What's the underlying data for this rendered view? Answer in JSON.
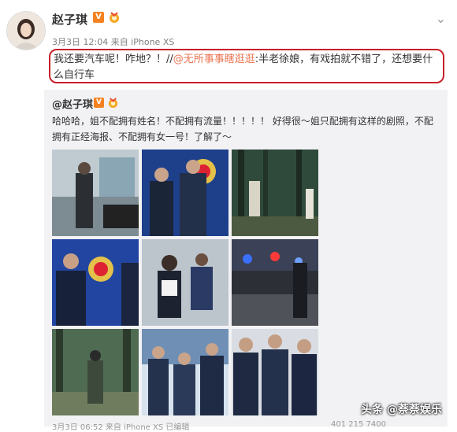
{
  "post": {
    "author": "赵子琪",
    "verified_badge": "V",
    "meta": "3月3日 12:04 来自 iPhone XS",
    "body_prefix": "我还要汽车呢！咋地？！//",
    "mention": "@无所事事瞎逛逛",
    "body_suffix": ":半老徐娘，有戏拍就不错了，还想要什么自行车"
  },
  "repost": {
    "author": "@赵子琪",
    "verified_badge": "V",
    "text": "哈哈哈，姐不配拥有姓名！不配拥有流量！！！！！ 好得很～姐只配拥有这样的剧照，不配拥有正经海报、不配拥有女一号！了解了～",
    "photos": [
      {
        "name": "office-man"
      },
      {
        "name": "police-officers-emblem"
      },
      {
        "name": "forest-scene"
      },
      {
        "name": "police-officer-emblem-2"
      },
      {
        "name": "running-scene"
      },
      {
        "name": "night-police-cars"
      },
      {
        "name": "forest-walk"
      },
      {
        "name": "police-group"
      },
      {
        "name": "police-trio"
      }
    ]
  },
  "footer": {
    "meta": "3月3日 06:52 来自 iPhone XS 已编辑",
    "stats": "401  215  7400"
  },
  "watermark": "头条 @萘萘娱乐",
  "colors": {
    "accent": "#eb7350",
    "highlight_border": "#c8202a",
    "badge": "#f58220"
  }
}
